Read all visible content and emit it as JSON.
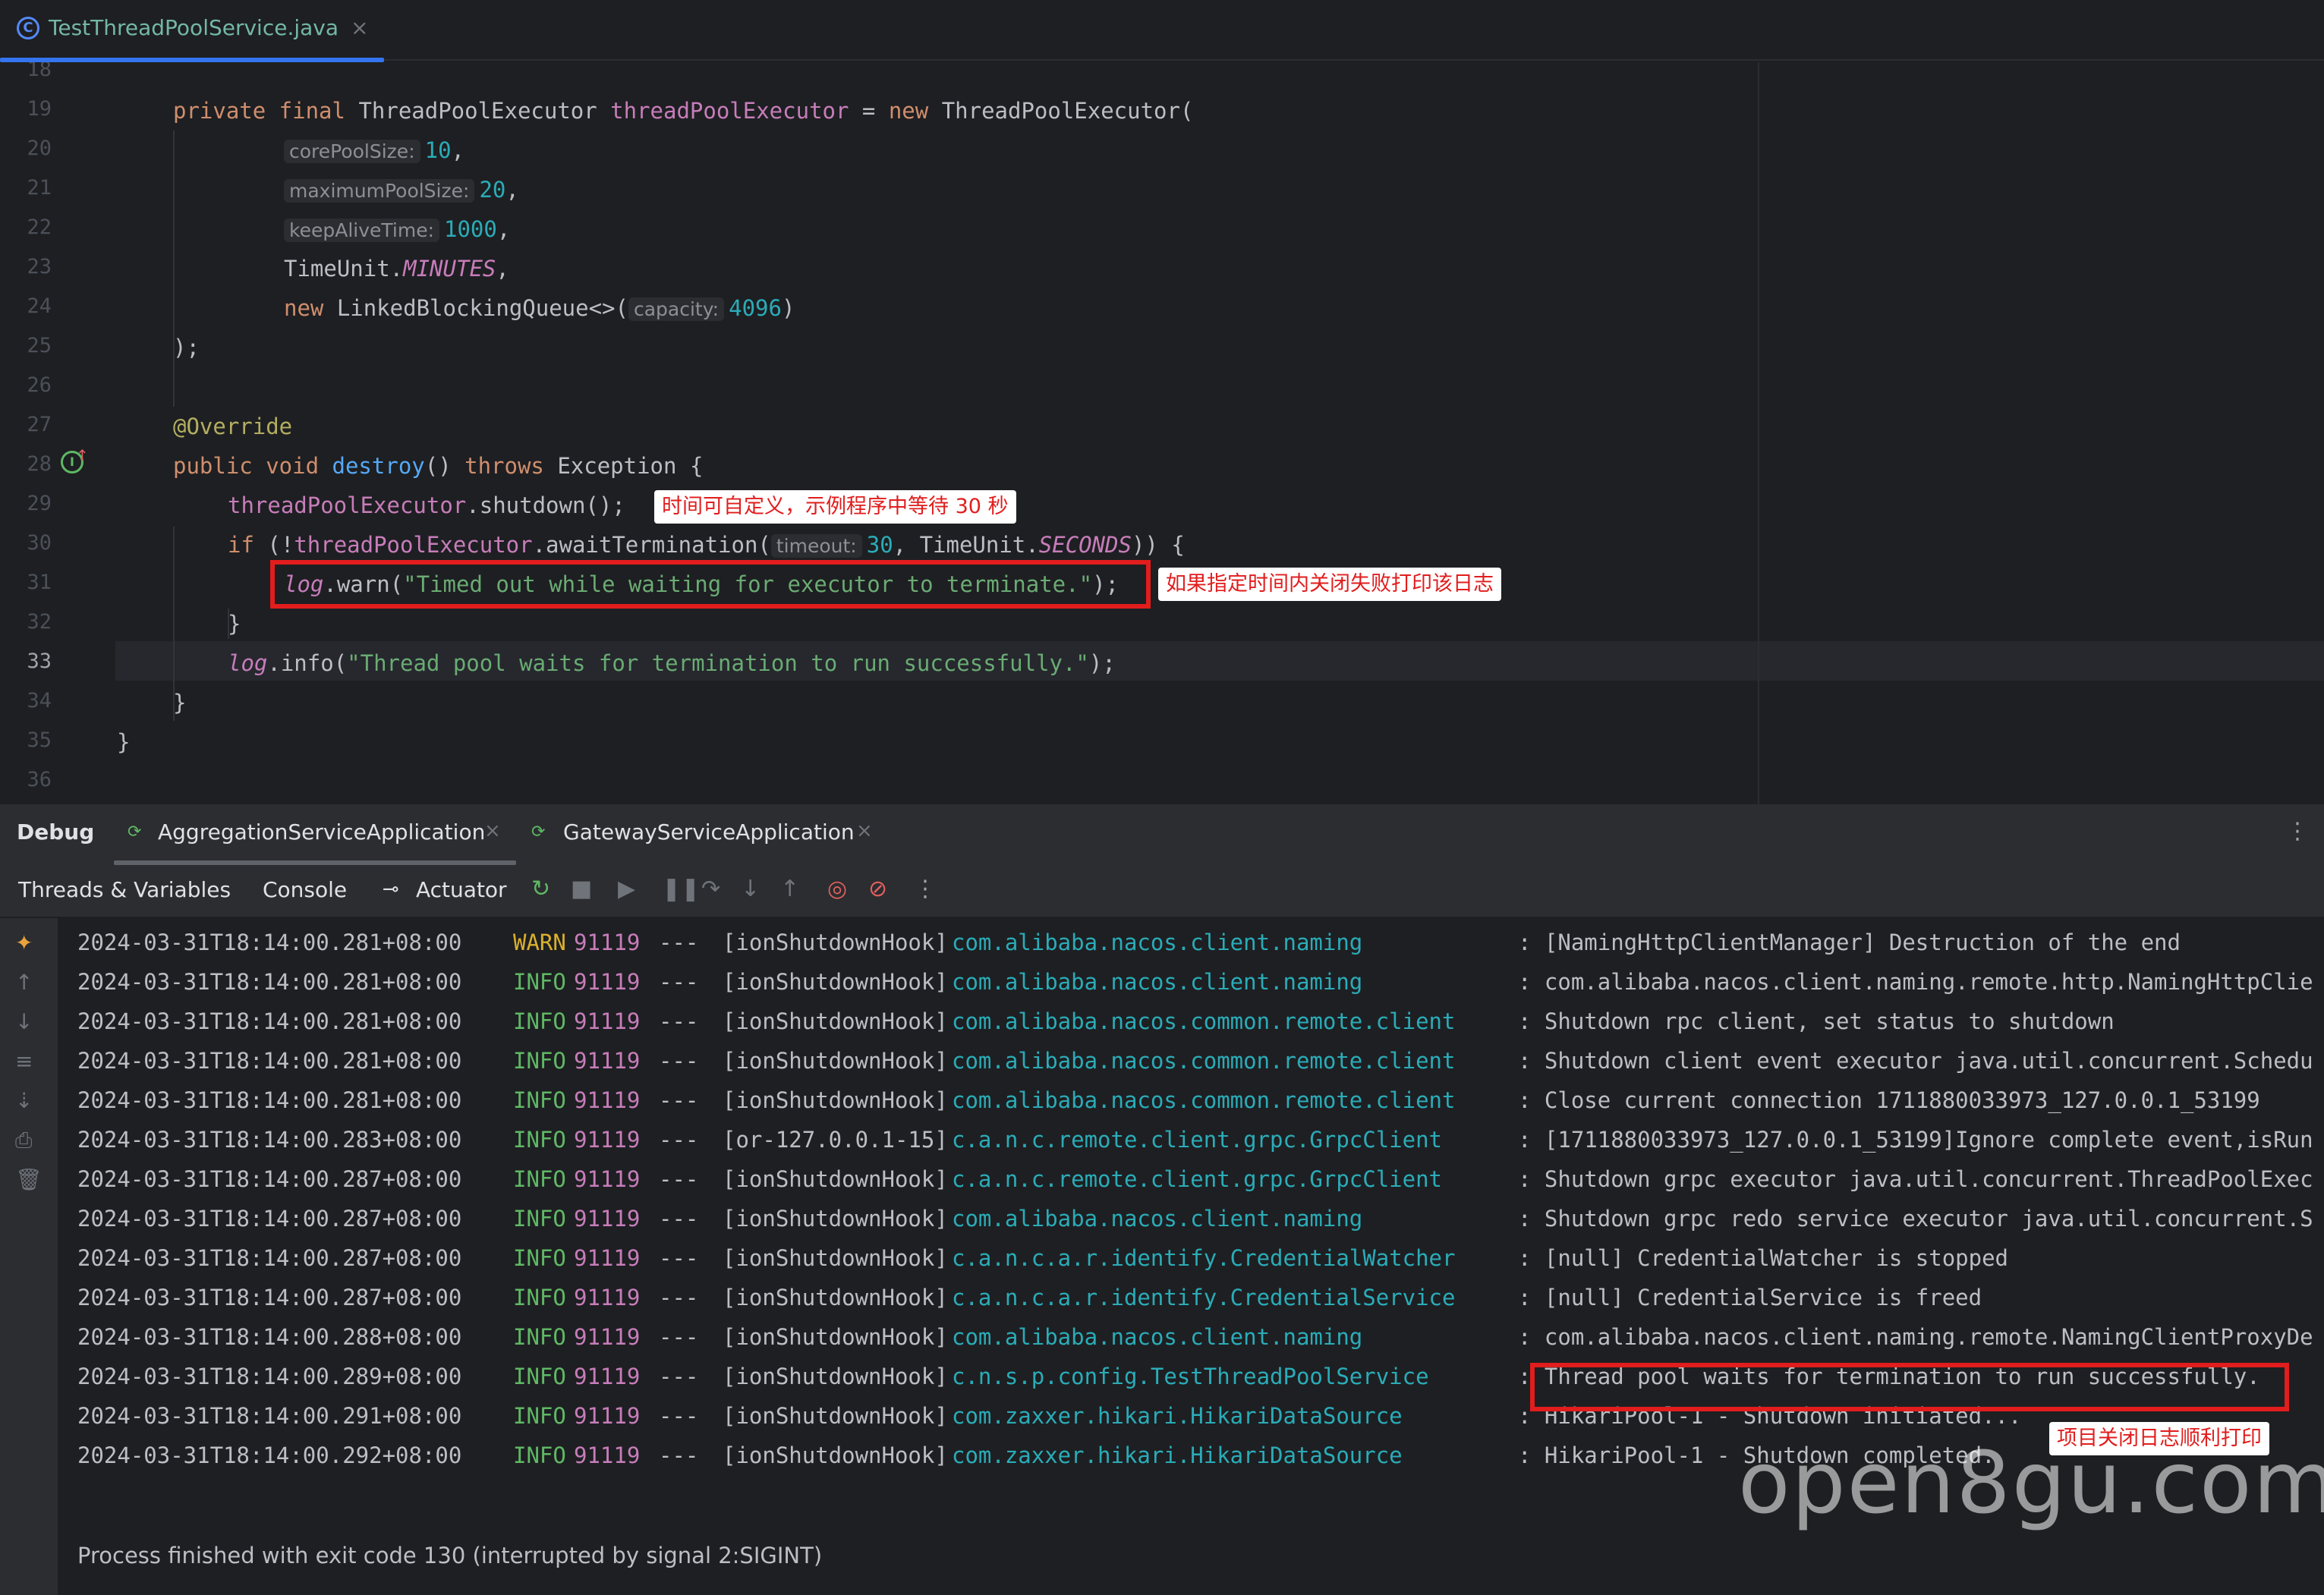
{
  "editor": {
    "tab": {
      "filename": "TestThreadPoolService.java",
      "icon": "class-icon"
    },
    "line_numbers": [
      "18",
      "19",
      "20",
      "21",
      "22",
      "23",
      "24",
      "25",
      "26",
      "27",
      "28",
      "29",
      "30",
      "31",
      "32",
      "33",
      "34",
      "35",
      "36"
    ],
    "current_line": "33",
    "code": {
      "l19": {
        "kw1": "private final ",
        "type": "ThreadPoolExecutor ",
        "field": "threadPoolExecutor",
        "eq": " = ",
        "kw2": "new ",
        "ctor": "ThreadPoolExecutor("
      },
      "l20": {
        "hint": "corePoolSize:",
        "value": "10",
        "tail": ","
      },
      "l21": {
        "hint": "maximumPoolSize:",
        "value": "20",
        "tail": ","
      },
      "l22": {
        "hint": "keepAliveTime:",
        "value": "1000",
        "tail": ","
      },
      "l23": {
        "cls": "TimeUnit.",
        "const": "MINUTES",
        "tail": ","
      },
      "l24": {
        "kw": "new ",
        "cls": "LinkedBlockingQueue<>(",
        "hint": "capacity:",
        "value": "4096",
        "tail": ")"
      },
      "l25": {
        "text": ");"
      },
      "l27": {
        "annotation": "@Override"
      },
      "l28": {
        "kw": "public void ",
        "method": "destroy",
        "mid": "() ",
        "kw2": "throws ",
        "tail": "Exception {"
      },
      "l29": {
        "field": "threadPoolExecutor",
        "tail": ".shutdown();"
      },
      "l30": {
        "kw": "if ",
        "p1": "(!",
        "field": "threadPoolExecutor",
        "p2": ".awaitTermination(",
        "hint": "timeout:",
        "value": "30",
        "p3": ", TimeUnit.",
        "const": "SECONDS",
        "p4": ")) {"
      },
      "l31": {
        "log": "log",
        "p1": ".warn(",
        "str": "\"Timed out while waiting for executor to terminate.\"",
        "p2": ");"
      },
      "l32": {
        "text": "}"
      },
      "l33": {
        "log": "log",
        "p1": ".info(",
        "str": "\"Thread pool waits for termination to run successfully.\"",
        "p2": ");"
      },
      "l34": {
        "text": "}"
      },
      "l35": {
        "text": "}"
      }
    },
    "annotations": {
      "timeout_note": "时间可自定义，示例程序中等待 30 秒",
      "warn_note": "如果指定时间内关闭失败打印该日志"
    }
  },
  "debug": {
    "title": "Debug",
    "tabs": [
      {
        "label": "AggregationServiceApplication"
      },
      {
        "label": "GatewayServiceApplication"
      }
    ],
    "toolbar": {
      "threads_label": "Threads & Variables",
      "console_label": "Console",
      "actuator_label": "Actuator"
    },
    "log_lines": [
      {
        "ts": "2024-03-31T18:14:00.281+08:00",
        "level": "WARN",
        "pid": "91119",
        "sep": "---",
        "thread": "[ionShutdownHook]",
        "logger": "com.alibaba.nacos.client.naming",
        "msg": ": [NamingHttpClientManager] Destruction of the end"
      },
      {
        "ts": "2024-03-31T18:14:00.281+08:00",
        "level": "INFO",
        "pid": "91119",
        "sep": "---",
        "thread": "[ionShutdownHook]",
        "logger": "com.alibaba.nacos.client.naming",
        "msg": ": com.alibaba.nacos.client.naming.remote.http.NamingHttpClie"
      },
      {
        "ts": "2024-03-31T18:14:00.281+08:00",
        "level": "INFO",
        "pid": "91119",
        "sep": "---",
        "thread": "[ionShutdownHook]",
        "logger": "com.alibaba.nacos.common.remote.client",
        "msg": ": Shutdown rpc client, set status to shutdown"
      },
      {
        "ts": "2024-03-31T18:14:00.281+08:00",
        "level": "INFO",
        "pid": "91119",
        "sep": "---",
        "thread": "[ionShutdownHook]",
        "logger": "com.alibaba.nacos.common.remote.client",
        "msg": ": Shutdown client event executor java.util.concurrent.Schedu"
      },
      {
        "ts": "2024-03-31T18:14:00.281+08:00",
        "level": "INFO",
        "pid": "91119",
        "sep": "---",
        "thread": "[ionShutdownHook]",
        "logger": "com.alibaba.nacos.common.remote.client",
        "msg": ": Close current connection 1711880033973_127.0.0.1_53199"
      },
      {
        "ts": "2024-03-31T18:14:00.283+08:00",
        "level": "INFO",
        "pid": "91119",
        "sep": "---",
        "thread": "[or-127.0.0.1-15]",
        "logger": "c.a.n.c.remote.client.grpc.GrpcClient",
        "msg": ": [1711880033973_127.0.0.1_53199]Ignore complete event,isRun"
      },
      {
        "ts": "2024-03-31T18:14:00.287+08:00",
        "level": "INFO",
        "pid": "91119",
        "sep": "---",
        "thread": "[ionShutdownHook]",
        "logger": "c.a.n.c.remote.client.grpc.GrpcClient",
        "msg": ": Shutdown grpc executor java.util.concurrent.ThreadPoolExec"
      },
      {
        "ts": "2024-03-31T18:14:00.287+08:00",
        "level": "INFO",
        "pid": "91119",
        "sep": "---",
        "thread": "[ionShutdownHook]",
        "logger": "com.alibaba.nacos.client.naming",
        "msg": ": Shutdown grpc redo service executor java.util.concurrent.S"
      },
      {
        "ts": "2024-03-31T18:14:00.287+08:00",
        "level": "INFO",
        "pid": "91119",
        "sep": "---",
        "thread": "[ionShutdownHook]",
        "logger": "c.a.n.c.a.r.identify.CredentialWatcher",
        "msg": ": [null] CredentialWatcher is stopped"
      },
      {
        "ts": "2024-03-31T18:14:00.287+08:00",
        "level": "INFO",
        "pid": "91119",
        "sep": "---",
        "thread": "[ionShutdownHook]",
        "logger": "c.a.n.c.a.r.identify.CredentialService",
        "msg": ": [null] CredentialService is freed"
      },
      {
        "ts": "2024-03-31T18:14:00.288+08:00",
        "level": "INFO",
        "pid": "91119",
        "sep": "---",
        "thread": "[ionShutdownHook]",
        "logger": "com.alibaba.nacos.client.naming",
        "msg": ": com.alibaba.nacos.client.naming.remote.NamingClientProxyDe"
      },
      {
        "ts": "2024-03-31T18:14:00.289+08:00",
        "level": "INFO",
        "pid": "91119",
        "sep": "---",
        "thread": "[ionShutdownHook]",
        "logger": "c.n.s.p.config.TestThreadPoolService",
        "msg": ": Thread pool waits for termination to run successfully."
      },
      {
        "ts": "2024-03-31T18:14:00.291+08:00",
        "level": "INFO",
        "pid": "91119",
        "sep": "---",
        "thread": "[ionShutdownHook]",
        "logger": "com.zaxxer.hikari.HikariDataSource",
        "msg": ": HikariPool-1 - Shutdown initiated..."
      },
      {
        "ts": "2024-03-31T18:14:00.292+08:00",
        "level": "INFO",
        "pid": "91119",
        "sep": "---",
        "thread": "[ionShutdownHook]",
        "logger": "com.zaxxer.hikari.HikariDataSource",
        "msg": ": HikariPool-1 - Shutdown completed."
      }
    ],
    "exit_message": "Process finished with exit code 130 (interrupted by signal 2:SIGINT)",
    "success_note": "项目关闭日志顺利打印"
  },
  "watermark": "open8gu.com",
  "colors": {
    "accent": "#3574f0",
    "annotation_red": "#e11d1d",
    "warn": "#d9b02e",
    "info": "#5fb865"
  }
}
